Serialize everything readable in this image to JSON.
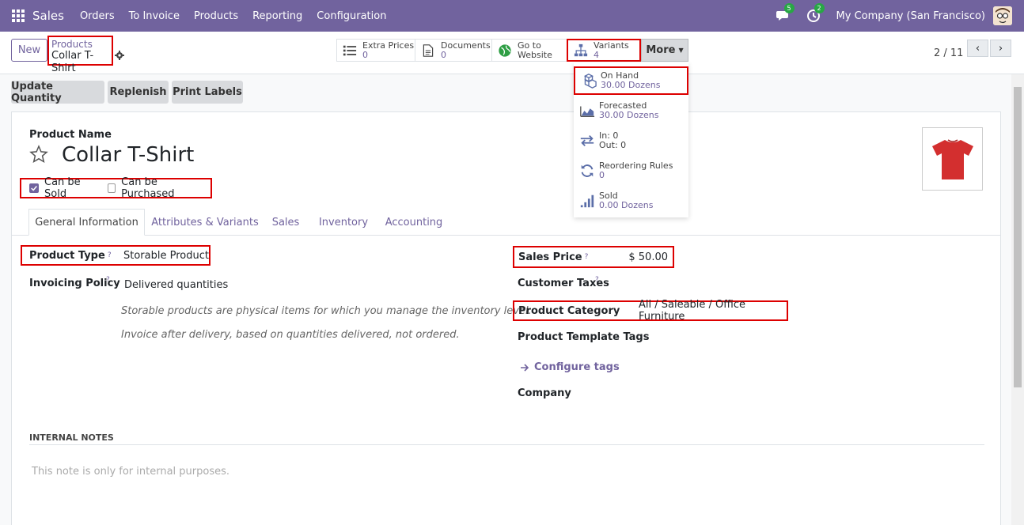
{
  "navbar": {
    "app_name": "Sales",
    "menu": [
      "Orders",
      "To Invoice",
      "Products",
      "Reporting",
      "Configuration"
    ],
    "messages_badge": "5",
    "activity_badge": "2",
    "company": "My Company (San Francisco)"
  },
  "control": {
    "new_label": "New",
    "breadcrumb_parent": "Products",
    "breadcrumb_current": "Collar T-Shirt",
    "pager": "2 / 11",
    "more_label": "More"
  },
  "smart_buttons": {
    "extra_prices": {
      "label": "Extra Prices",
      "value": "0"
    },
    "documents": {
      "label": "Documents",
      "value": "0"
    },
    "website": {
      "label_line1": "Go to",
      "label_line2": "Website"
    },
    "variants": {
      "label": "Variants",
      "value": "4"
    }
  },
  "dropdown": {
    "on_hand": {
      "label": "On Hand",
      "value": "30.00 Dozens"
    },
    "forecasted": {
      "label": "Forecasted",
      "value": "30.00 Dozens"
    },
    "in_out": {
      "in": "In: 0",
      "out": "Out: 0"
    },
    "reordering": {
      "label": "Reordering Rules",
      "value": "0"
    },
    "sold": {
      "label": "Sold",
      "value": "0.00 Dozens"
    }
  },
  "actions": [
    "Update Quantity",
    "Replenish",
    "Print Labels"
  ],
  "form": {
    "name_label": "Product Name",
    "name": "Collar T-Shirt",
    "can_be_sold": "Can be Sold",
    "can_be_purchased": "Can be Purchased",
    "tabs": [
      "General Information",
      "Attributes & Variants",
      "Sales",
      "Inventory",
      "Accounting"
    ],
    "product_type_label": "Product Type",
    "product_type": "Storable Product",
    "invoicing_label": "Invoicing Policy",
    "invoicing": "Delivered quantities",
    "hint1": "Storable products are physical items for which you manage the inventory level.",
    "hint2": "Invoice after delivery, based on quantities delivered, not ordered.",
    "sales_price_label": "Sales Price",
    "sales_price": "$ 50.00",
    "customer_taxes_label": "Customer Taxes",
    "category_label": "Product Category",
    "category": "All / Saleable / Office Furniture",
    "tags_label": "Product Template Tags",
    "configure_tags": "Configure tags",
    "company_label": "Company",
    "help_mark": "?",
    "notes_header": "INTERNAL NOTES",
    "notes_placeholder": "This note is only for internal purposes."
  },
  "colors": {
    "brand": "#71639e",
    "highlight": "#dd0000",
    "shirt": "#d32f2f"
  }
}
